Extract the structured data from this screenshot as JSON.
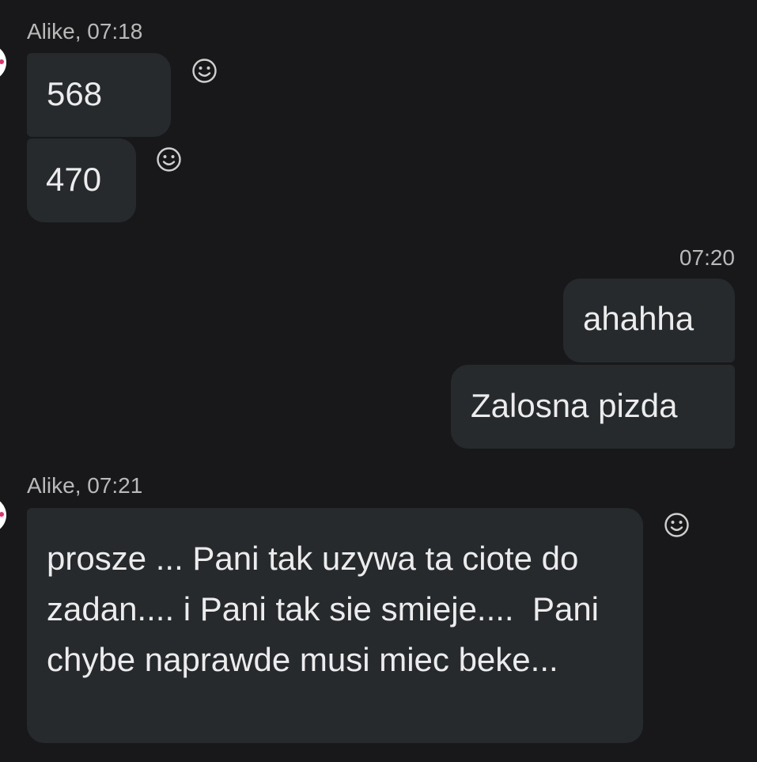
{
  "conversation": {
    "group1": {
      "sender": "Alike, 07:18",
      "messages": [
        "568",
        "470"
      ]
    },
    "group2": {
      "timestamp": "07:20",
      "messages": [
        "ahahha",
        "Zalosna pizda"
      ]
    },
    "group3": {
      "sender": "Alike, 07:21",
      "messages": [
        "prosze ... Pani tak uzywa ta ciote do zadan.... i Pani tak sie smieje....  Pani chybe naprawde musi miec beke..."
      ]
    }
  },
  "icons": {
    "reaction": "smiley-react-icon",
    "avatar": "contact-avatar"
  },
  "colors": {
    "background": "#18181a",
    "bubble": "#262a2d",
    "text": "#ececec",
    "meta_text": "#b9b9b9"
  }
}
